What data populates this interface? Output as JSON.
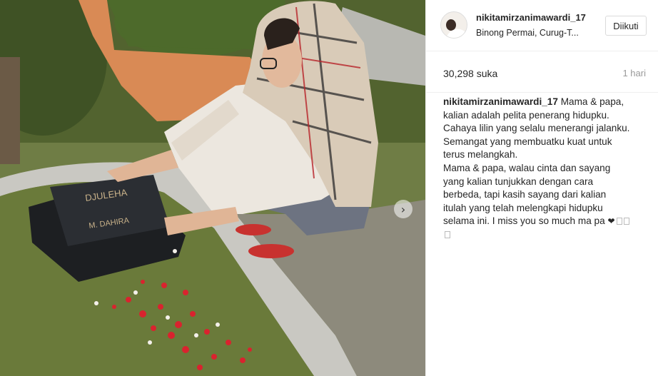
{
  "post": {
    "username": "nikitamirzanimawardi_17",
    "location": "Binong Permai, Curug-T...",
    "follow_label": "Diikuti",
    "likes": "30,298 suka",
    "time": "1 hari",
    "caption_user": "nikitamirzanimawardi_17",
    "caption_lines": [
      "Mama & papa,",
      "kalian adalah pelita penerang hidupku.",
      "Cahaya lilin yang selalu menerangi jalanku.",
      "Semangat yang membuatku kuat untuk",
      "terus melangkah.",
      "Mama & papa, walau cinta dan sayang",
      "yang kalian tunjukkan dengan cara",
      "berbeda, tapi kasih sayang dari kalian",
      "itulah yang telah melengkapi hidupku",
      "selama ini. I miss you so much ma pa"
    ],
    "heart_glyph": "❤"
  },
  "photo": {
    "gravestone_line1": "DJULEHA",
    "gravestone_line2": "M. DAHIRA",
    "carousel_arrow": "›"
  },
  "icons": {
    "avatar": "profile-photo-icon",
    "next": "chevron-right-icon"
  },
  "colors": {
    "border": "#efefef",
    "text": "#262626",
    "muted": "#999999"
  }
}
